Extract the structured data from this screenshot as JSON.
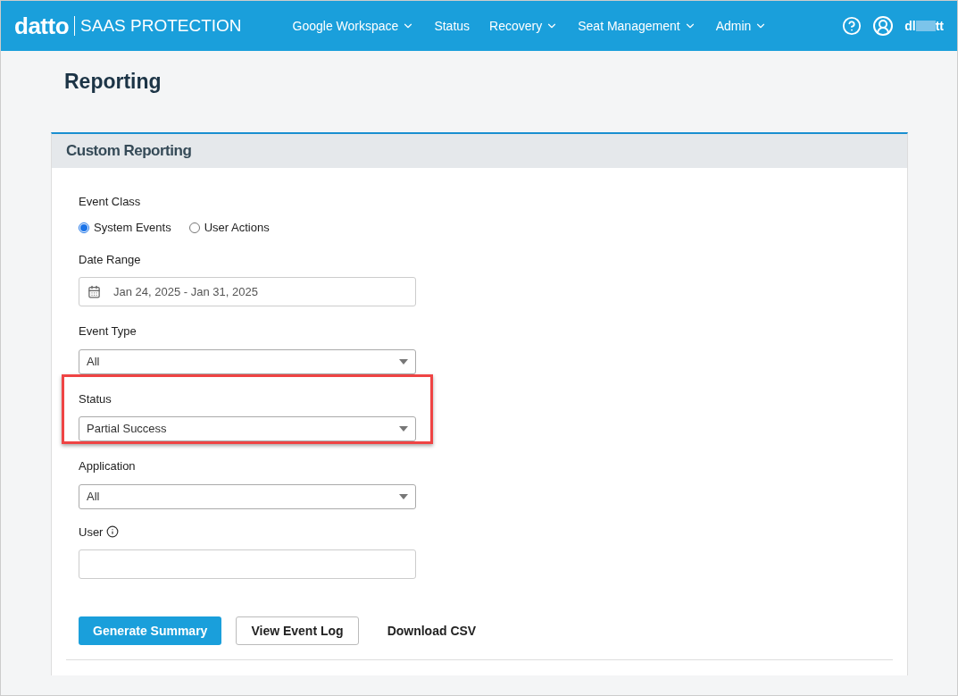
{
  "nav": {
    "logo": "datto",
    "product": "SAAS PROTECTION",
    "items": [
      {
        "label": "Google Workspace",
        "dropdown": true
      },
      {
        "label": "Status",
        "dropdown": false
      },
      {
        "label": "Recovery",
        "dropdown": true
      },
      {
        "label": "Seat Management",
        "dropdown": true
      },
      {
        "label": "Admin",
        "dropdown": true
      }
    ],
    "user": {
      "name_start": "dl",
      "name_end": "tt"
    }
  },
  "page_title": "Reporting",
  "card": {
    "title": "Custom Reporting",
    "fields": [
      {
        "kind": "radio",
        "label": "Event Class",
        "options": [
          {
            "label": "System Events",
            "selected": true
          },
          {
            "label": "User Actions",
            "selected": false
          }
        ]
      },
      {
        "kind": "date",
        "label": "Date Range",
        "value": "Jan 24, 2025 - Jan 31, 2025"
      },
      {
        "kind": "select",
        "label": "Event Type",
        "value": "All",
        "highlighted": false
      },
      {
        "kind": "select",
        "label": "Status",
        "value": "Partial Success",
        "highlighted": true
      },
      {
        "kind": "select",
        "label": "Application",
        "value": "All",
        "highlighted": false
      },
      {
        "kind": "text",
        "label": "User",
        "info": true
      }
    ],
    "buttons": [
      {
        "kind": "primary",
        "label": "Generate Summary"
      },
      {
        "kind": "outline",
        "label": "View Event Log"
      },
      {
        "kind": "link",
        "label": "Download CSV"
      }
    ]
  }
}
